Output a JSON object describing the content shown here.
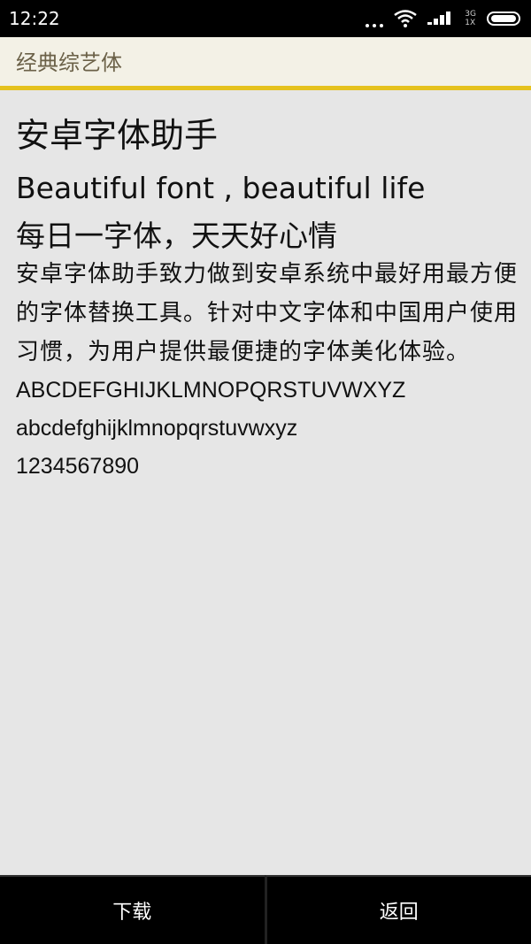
{
  "status_bar": {
    "time": "12:22",
    "network_top": "3G",
    "network_bottom": "1X"
  },
  "title_bar": {
    "title": "经典综艺体"
  },
  "content": {
    "app_title": "安卓字体助手",
    "tagline_en": "Beautiful font , beautiful life",
    "tagline_cn": "每日一字体，天天好心情",
    "description": "安卓字体助手致力做到安卓系统中最好用最方便的字体替换工具。针对中文字体和中国用户使用习惯，为用户提供最便捷的字体美化体验。",
    "sample_upper": "ABCDEFGHIJKLMNOPQRSTUVWXYZ",
    "sample_lower": "abcdefghijklmnopqrstuvwxyz",
    "sample_digits": "1234567890"
  },
  "buttons": {
    "download": "下载",
    "back": "返回"
  },
  "colors": {
    "accent": "#e5c21d",
    "title_bar_bg": "#f3f1e6",
    "content_bg": "#e6e6e6",
    "bottom_bar_bg": "#000000"
  }
}
